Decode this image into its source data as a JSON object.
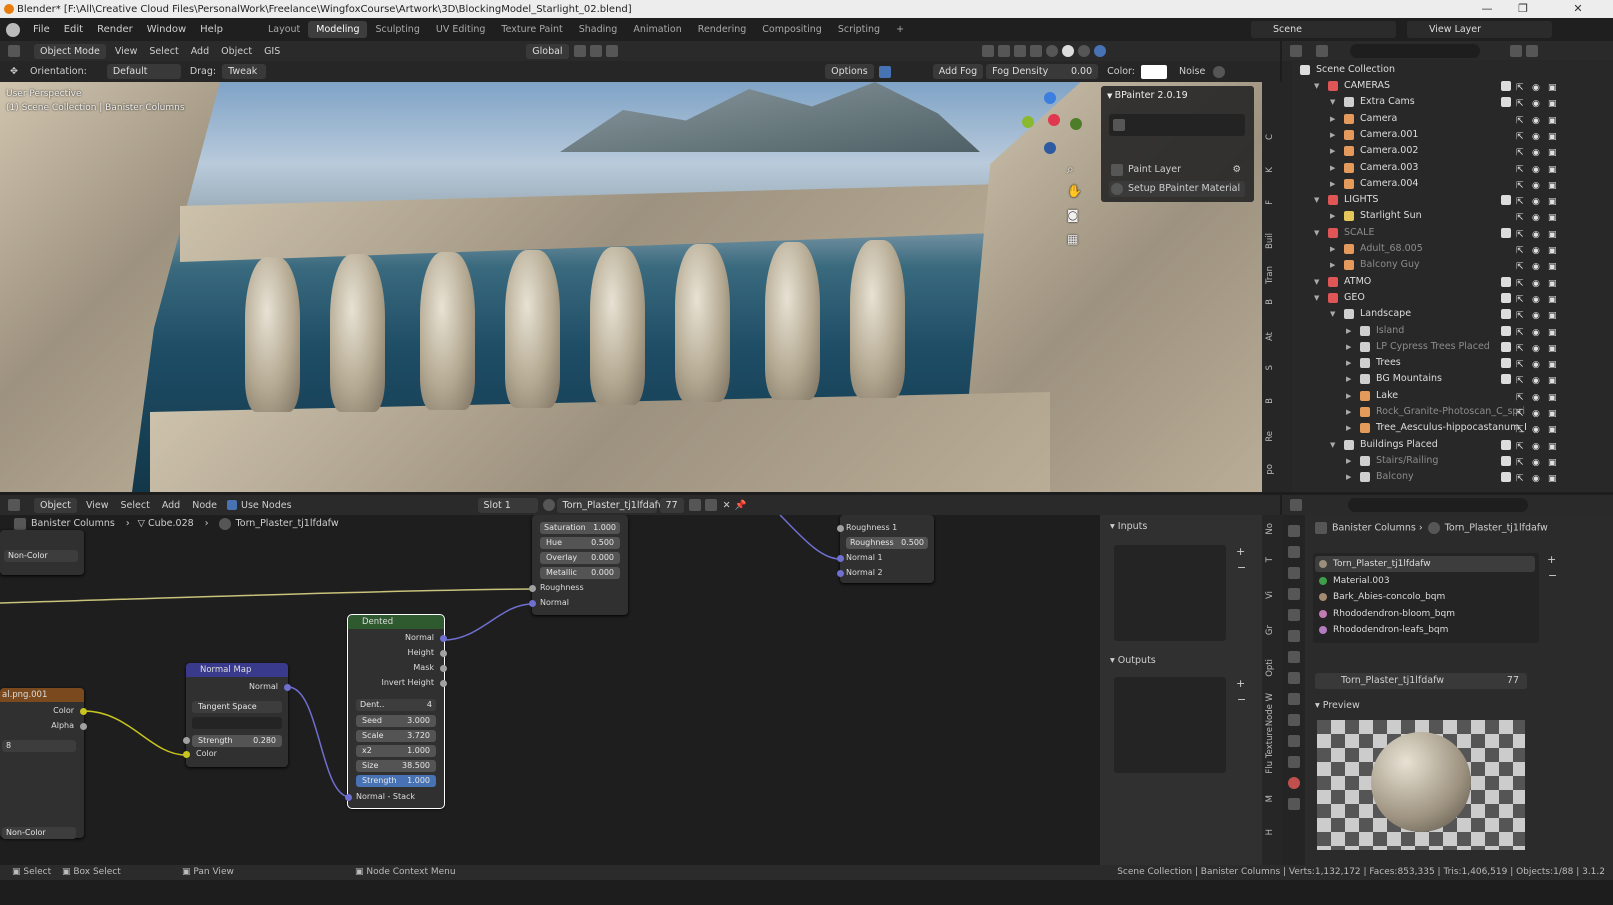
{
  "window": {
    "title": "Blender* [F:\\All\\Creative Cloud Files\\PersonalWork\\Freelance\\WingfoxCourse\\Artwork\\3D\\BlockingModel_Starlight_02.blend]",
    "minimize": "—",
    "maximize": "❐",
    "close": "✕"
  },
  "menus": [
    "File",
    "Edit",
    "Render",
    "Window",
    "Help"
  ],
  "workspaces": [
    "Layout",
    "Modeling",
    "Sculpting",
    "UV Editing",
    "Texture Paint",
    "Shading",
    "Animation",
    "Rendering",
    "Compositing",
    "Scripting",
    "+"
  ],
  "active_workspace": "Modeling",
  "scene": {
    "name": "Scene",
    "view_layer": "View Layer"
  },
  "viewport_header": {
    "mode": "Object Mode",
    "menus": [
      "View",
      "Select",
      "Add",
      "Object",
      "GIS"
    ],
    "transform": "Global"
  },
  "tool_header": {
    "orientation_label": "Orientation:",
    "orientation": "Default",
    "drag_label": "Drag:",
    "drag": "Tweak",
    "options": "Options",
    "add_fog": "Add Fog",
    "fog_density_label": "Fog Density",
    "fog_density": "0.00",
    "color_label": "Color:",
    "noise": "Noise"
  },
  "viewport": {
    "perspective": "User Perspective",
    "collection": "(1) Scene Collection | Banister Columns"
  },
  "bpainter": {
    "title": "BPainter 2.0.19",
    "paint_layer": "Paint Layer",
    "setup": "Setup BPainter Material"
  },
  "viewport_tabs": [
    "C",
    "K",
    "F",
    "Buil",
    "Tran",
    "B",
    "At",
    "S",
    "B",
    "Re",
    "po"
  ],
  "outliner": {
    "root": "Scene Collection",
    "rows": [
      {
        "label": "CAMERAS",
        "indent": 1,
        "type": "collection",
        "dim": false
      },
      {
        "label": "Extra Cams",
        "indent": 2,
        "type": "collection",
        "dim": false
      },
      {
        "label": "Camera",
        "indent": 2,
        "type": "camera",
        "dim": false
      },
      {
        "label": "Camera.001",
        "indent": 2,
        "type": "camera",
        "dim": false
      },
      {
        "label": "Camera.002",
        "indent": 2,
        "type": "camera",
        "dim": false
      },
      {
        "label": "Camera.003",
        "indent": 2,
        "type": "camera",
        "dim": false
      },
      {
        "label": "Camera.004",
        "indent": 2,
        "type": "camera",
        "dim": false
      },
      {
        "label": "LIGHTS",
        "indent": 1,
        "type": "collection",
        "dim": false
      },
      {
        "label": "Starlight Sun",
        "indent": 2,
        "type": "light",
        "dim": false
      },
      {
        "label": "SCALE",
        "indent": 1,
        "type": "collection",
        "dim": true
      },
      {
        "label": "Adult_68.005",
        "indent": 2,
        "type": "mesh",
        "dim": true
      },
      {
        "label": "Balcony Guy",
        "indent": 2,
        "type": "mesh",
        "dim": true
      },
      {
        "label": "ATMO",
        "indent": 1,
        "type": "collection",
        "dim": false
      },
      {
        "label": "GEO",
        "indent": 1,
        "type": "collection",
        "dim": false
      },
      {
        "label": "Landscape",
        "indent": 2,
        "type": "collection",
        "dim": false
      },
      {
        "label": "Island",
        "indent": 3,
        "type": "collection",
        "dim": true
      },
      {
        "label": "LP Cypress Trees Placed",
        "indent": 3,
        "type": "collection",
        "dim": true
      },
      {
        "label": "Trees",
        "indent": 3,
        "type": "collection",
        "dim": false
      },
      {
        "label": "BG Mountains",
        "indent": 3,
        "type": "collection",
        "dim": false
      },
      {
        "label": "Lake",
        "indent": 3,
        "type": "mesh",
        "dim": false
      },
      {
        "label": "Rock_Granite-Photoscan_C_spri",
        "indent": 3,
        "type": "mesh",
        "dim": true
      },
      {
        "label": "Tree_Aesculus-hippocastanum_I",
        "indent": 3,
        "type": "mesh",
        "dim": false
      },
      {
        "label": "Buildings Placed",
        "indent": 2,
        "type": "collection",
        "dim": false
      },
      {
        "label": "Stairs/Railing",
        "indent": 3,
        "type": "collection",
        "dim": true
      },
      {
        "label": "Balcony",
        "indent": 3,
        "type": "collection",
        "dim": true
      }
    ]
  },
  "node_header": {
    "type": "Object",
    "menus": [
      "View",
      "Select",
      "Add",
      "Node"
    ],
    "use_nodes": "Use Nodes",
    "slot": "Slot 1",
    "material": "Torn_Plaster_tj1lfdafw",
    "users": "77"
  },
  "breadcrumb": [
    "Banister Columns",
    "Cube.028",
    "Torn_Plaster_tj1lfdafw"
  ],
  "nodes": {
    "left_node": {
      "select": "Non-Color",
      "select2": "Non-Color",
      "color": "Color",
      "alpha": "Alpha",
      "label": "al.png.001",
      "count": "8"
    },
    "normal_map": {
      "title": "Normal Map",
      "out": "Normal",
      "space": "Tangent Space",
      "strength_label": "Strength",
      "strength": "0.280",
      "color": "Color"
    },
    "dented": {
      "title": "Dented",
      "outputs": [
        "Normal",
        "Height",
        "Mask",
        "Invert Height"
      ],
      "image": "Dent..",
      "image_users": "4",
      "seed_label": "Seed",
      "seed": "3.000",
      "scale_label": "Scale",
      "scale": "3.720",
      "x2_label": "x2",
      "x2": "1.000",
      "size_label": "Size",
      "size": "38.500",
      "strength_label": "Strength",
      "strength": "1.000",
      "stack": "Normal - Stack"
    },
    "middle": {
      "saturation_label": "Saturation",
      "saturation": "1.000",
      "hue_label": "Hue",
      "hue": "0.500",
      "overlay_label": "Overlay",
      "overlay": "0.000",
      "metallic_label": "Metallic",
      "metallic": "0.000",
      "roughness": "Roughness",
      "normal": "Normal"
    },
    "right": {
      "roughness1": "Roughness 1",
      "roughness_label": "Roughness",
      "roughness": "0.500",
      "normal1": "Normal 1",
      "normal2": "Normal 2"
    }
  },
  "npanel": {
    "inputs": "Inputs",
    "outputs": "Outputs",
    "tabs": [
      "No",
      "T",
      "Vi",
      "Gr",
      "Opti",
      "Node W",
      "Texture",
      "Flu",
      "M",
      "H"
    ]
  },
  "properties": {
    "breadcrumb": [
      "Banister Columns",
      "Torn_Plaster_tj1lfdafw"
    ],
    "materials": [
      {
        "name": "Torn_Plaster_tj1lfdafw",
        "color": "#9a8e7c"
      },
      {
        "name": "Material.003",
        "color": "#3f9e4a"
      },
      {
        "name": "Bark_Abies-concolo_bqm",
        "color": "#a58a72"
      },
      {
        "name": "Rhododendron-bloom_bqm",
        "color": "#c07bb5"
      },
      {
        "name": "Rhododendron-leafs_bqm",
        "color": "#b37cc0"
      }
    ],
    "material": "Torn_Plaster_tj1lfdafw",
    "users": "77",
    "preview": "Preview"
  },
  "status": {
    "select": "Select",
    "box_select": "Box Select",
    "pan": "Pan View",
    "context": "Node Context Menu",
    "stats": "Scene Collection | Banister Columns | Verts:1,132,172 | Faces:853,335 | Tris:1,406,519 | Objects:1/88 | 3.1.2"
  },
  "colors": {
    "accent": "#4772b3",
    "orange": "#f5a142",
    "header": "#2a2a2a"
  }
}
